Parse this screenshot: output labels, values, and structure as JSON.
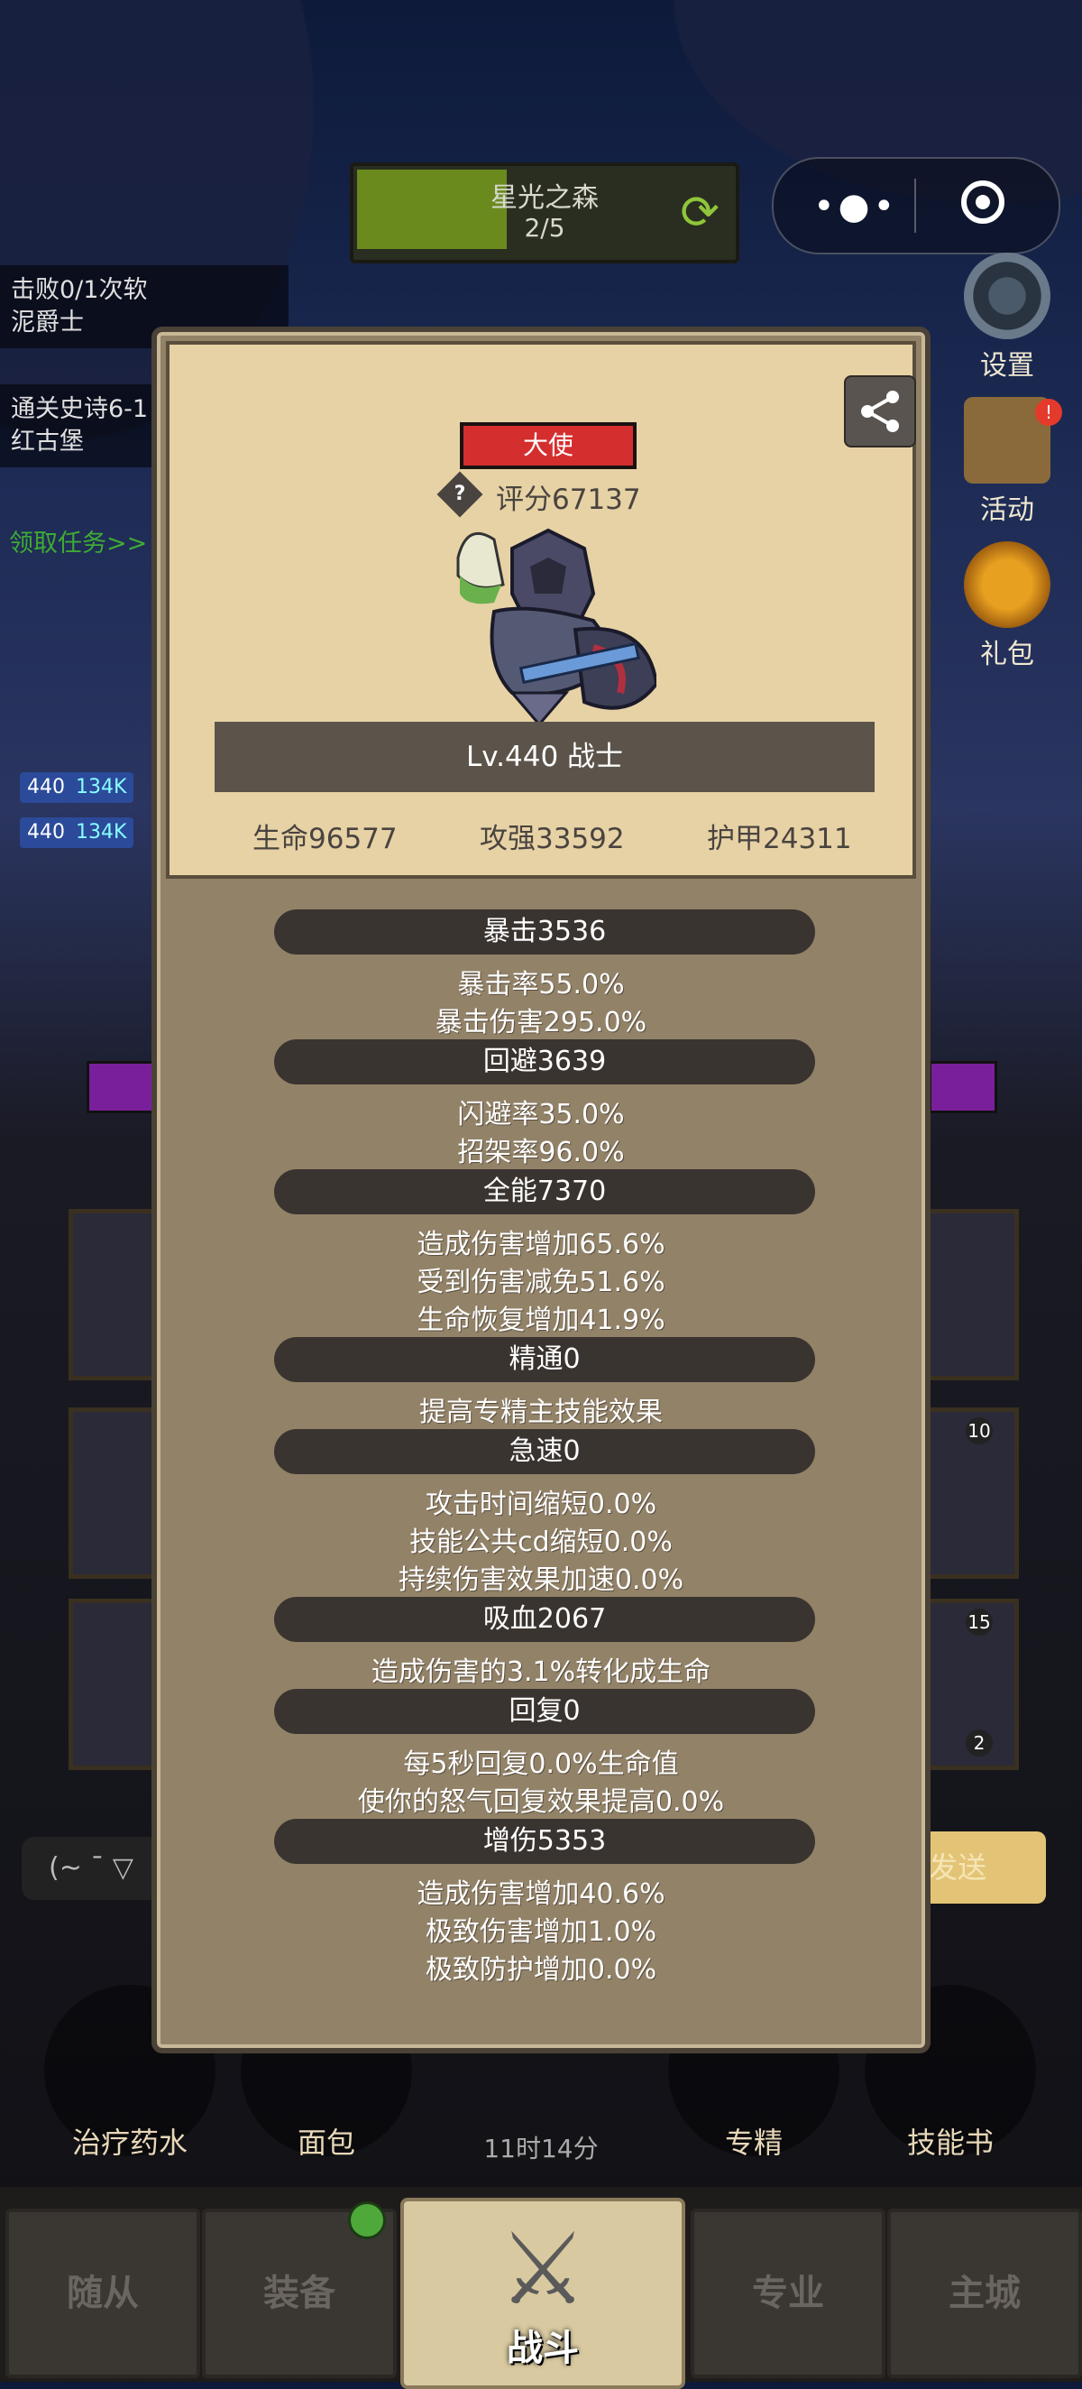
{
  "stage": {
    "name": "星光之森",
    "progress": "2/5",
    "fill_fraction": 0.4
  },
  "quests": [
    {
      "line1": "击败0/1次软",
      "line2": "泥爵士"
    },
    {
      "line1": "通关史诗6-1",
      "line2": "红古堡"
    }
  ],
  "quest_claim": "领取任务>>",
  "hp_tags": [
    {
      "level": "440",
      "value": "134K"
    },
    {
      "level": "440",
      "value": "134K"
    }
  ],
  "side_buttons": [
    {
      "label": "设置",
      "icon": "gear-icon"
    },
    {
      "label": "活动",
      "icon": "event-board-icon",
      "badge": "!"
    },
    {
      "label": "礼包",
      "icon": "gift-icon"
    }
  ],
  "card_counts": [
    "10",
    "15",
    "2"
  ],
  "chat_placeholder": "(~ ˉ ▽",
  "send_label": "发送",
  "consumables": [
    "治疗药水",
    "面包",
    "专精",
    "技能书"
  ],
  "timer": "11时14分",
  "nav": {
    "tabs": [
      "随从",
      "装备",
      "战斗",
      "专业",
      "主城"
    ]
  },
  "hero": {
    "title_badge": "大使",
    "score": "评分67137",
    "level_class": "Lv.440 战士",
    "hp": "生命96577",
    "attack": "攻强33592",
    "armor": "护甲24311"
  },
  "attributes": [
    {
      "name": "暴击3536",
      "details": [
        "暴击率55.0%",
        "暴击伤害295.0%"
      ]
    },
    {
      "name": "回避3639",
      "details": [
        "闪避率35.0%",
        "招架率96.0%"
      ]
    },
    {
      "name": "全能7370",
      "details": [
        "造成伤害增加65.6%",
        "受到伤害减免51.6%",
        "生命恢复增加41.9%"
      ]
    },
    {
      "name": "精通0",
      "details": [
        "提高专精主技能效果"
      ]
    },
    {
      "name": "急速0",
      "details": [
        "攻击时间缩短0.0%",
        "技能公共cd缩短0.0%",
        "持续伤害效果加速0.0%"
      ]
    },
    {
      "name": "吸血2067",
      "details": [
        "造成伤害的3.1%转化成生命"
      ]
    },
    {
      "name": "回复0",
      "details": [
        "每5秒回复0.0%生命值",
        "使你的怒气回复效果提高0.0%"
      ]
    },
    {
      "name": "增伤5353",
      "details": [
        "造成伤害增加40.6%",
        "极致伤害增加1.0%",
        "极致防护增加0.0%"
      ]
    }
  ]
}
